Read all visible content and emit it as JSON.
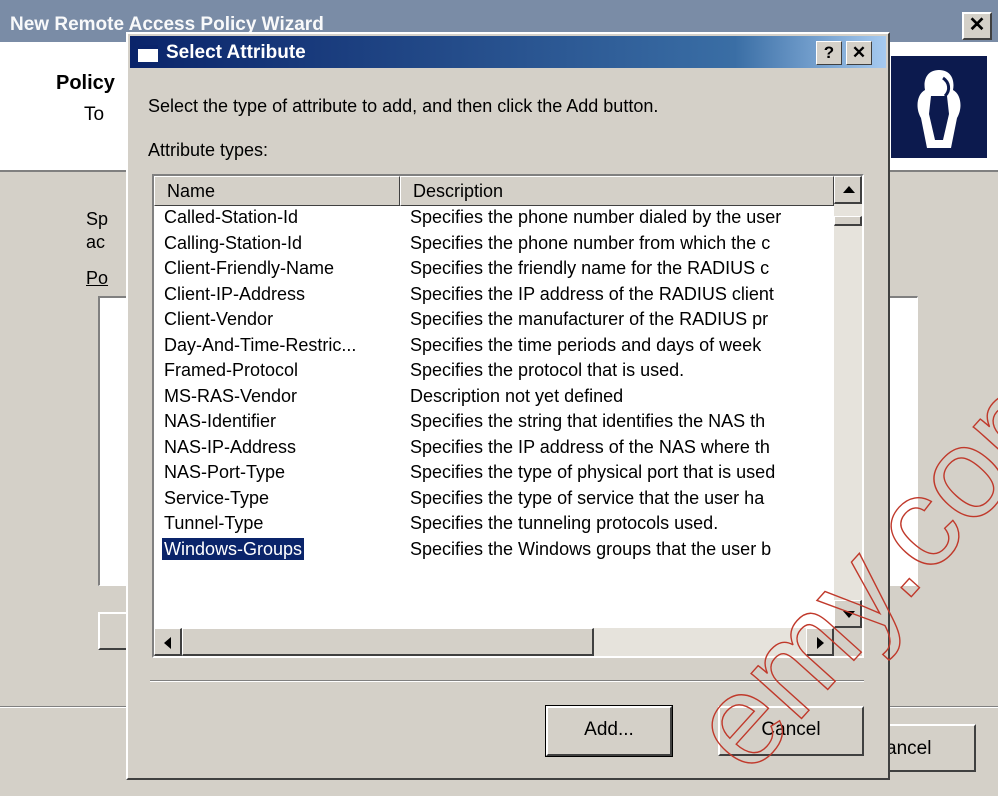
{
  "background_wizard": {
    "title": "New Remote Access Policy Wizard",
    "close_glyph": "✕",
    "header_title": "Policy",
    "header_subtitle": "To",
    "body_text_1": "Sp",
    "body_text_2": "ac",
    "list_label": "Po",
    "cancel_label": "ancel"
  },
  "dialog": {
    "title": "Select Attribute",
    "help_glyph": "?",
    "close_glyph": "✕",
    "instruction": "Select the type of attribute to add, and then click the Add button.",
    "list_label": "Attribute types:",
    "columns": {
      "name": "Name",
      "description": "Description"
    },
    "rows": [
      {
        "name": "Called-Station-Id",
        "description": "Specifies the phone number dialed by the user"
      },
      {
        "name": "Calling-Station-Id",
        "description": "Specifies the phone number from which the c"
      },
      {
        "name": "Client-Friendly-Name",
        "description": "Specifies the friendly name for the RADIUS c"
      },
      {
        "name": "Client-IP-Address",
        "description": "Specifies the IP address of the RADIUS client"
      },
      {
        "name": "Client-Vendor",
        "description": "Specifies the manufacturer of the RADIUS pr"
      },
      {
        "name": "Day-And-Time-Restric...",
        "description": "Specifies the time periods and days of week"
      },
      {
        "name": "Framed-Protocol",
        "description": "Specifies the protocol that is used."
      },
      {
        "name": "MS-RAS-Vendor",
        "description": "Description not yet defined"
      },
      {
        "name": "NAS-Identifier",
        "description": "Specifies the string that identifies the NAS th"
      },
      {
        "name": "NAS-IP-Address",
        "description": "Specifies the IP address of the NAS where th"
      },
      {
        "name": "NAS-Port-Type",
        "description": "Specifies the type of physical port that is used"
      },
      {
        "name": "Service-Type",
        "description": "Specifies the type of service that the user ha"
      },
      {
        "name": "Tunnel-Type",
        "description": "Specifies the tunneling protocols used."
      },
      {
        "name": "Windows-Groups",
        "description": "Specifies the Windows groups that the user b"
      }
    ],
    "selected_row": "Windows-Groups",
    "add_label": "Add...",
    "cancel_label": "Cancel"
  },
  "watermark": "emy.com",
  "icons": [
    "person-logo-icon",
    "help-icon",
    "close-icon",
    "scroll-up-icon",
    "scroll-down-icon",
    "scroll-left-icon",
    "scroll-right-icon"
  ],
  "colors": {
    "titlebar_start": "#0a246a",
    "titlebar_end": "#a6caf0",
    "selection": "#0a246a",
    "face": "#d4d0c8"
  }
}
